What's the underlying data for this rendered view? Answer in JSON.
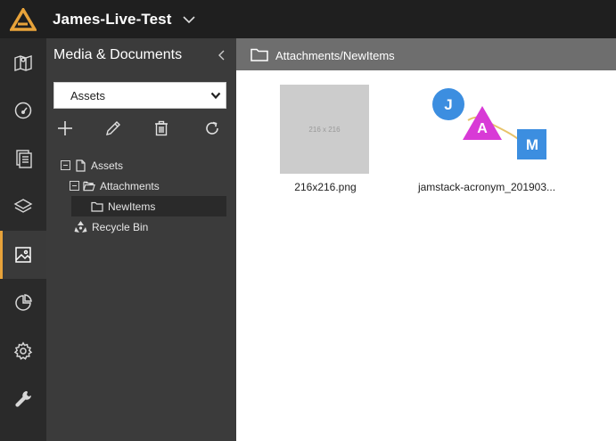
{
  "app": {
    "site_title": "James-Live-Test",
    "accent": "#e8a33a"
  },
  "nav": {
    "items": [
      {
        "icon": "map-icon"
      },
      {
        "icon": "dashboard-icon"
      },
      {
        "icon": "pages-icon"
      },
      {
        "icon": "layers-icon"
      },
      {
        "icon": "media-icon",
        "active": true
      },
      {
        "icon": "analytics-icon"
      },
      {
        "icon": "settings-icon"
      },
      {
        "icon": "tools-icon"
      }
    ]
  },
  "panel": {
    "title": "Media & Documents",
    "library_select": {
      "value": "Assets"
    },
    "toolbar": [
      "add-icon",
      "edit-icon",
      "delete-icon",
      "refresh-icon"
    ],
    "tree": [
      {
        "label": "Assets",
        "level": 0,
        "expanded": true
      },
      {
        "label": "Attachments",
        "level": 1,
        "expanded": true
      },
      {
        "label": "NewItems",
        "level": 2,
        "selected": true
      },
      {
        "label": "Recycle Bin",
        "level": 0
      }
    ]
  },
  "main": {
    "path": "Attachments/NewItems",
    "files": [
      {
        "name": "216x216.png",
        "thumb_text": "216 x 216"
      },
      {
        "name": "jamstack-acronym_201903...",
        "thumb_letters": [
          "J",
          "A",
          "M"
        ]
      }
    ]
  }
}
